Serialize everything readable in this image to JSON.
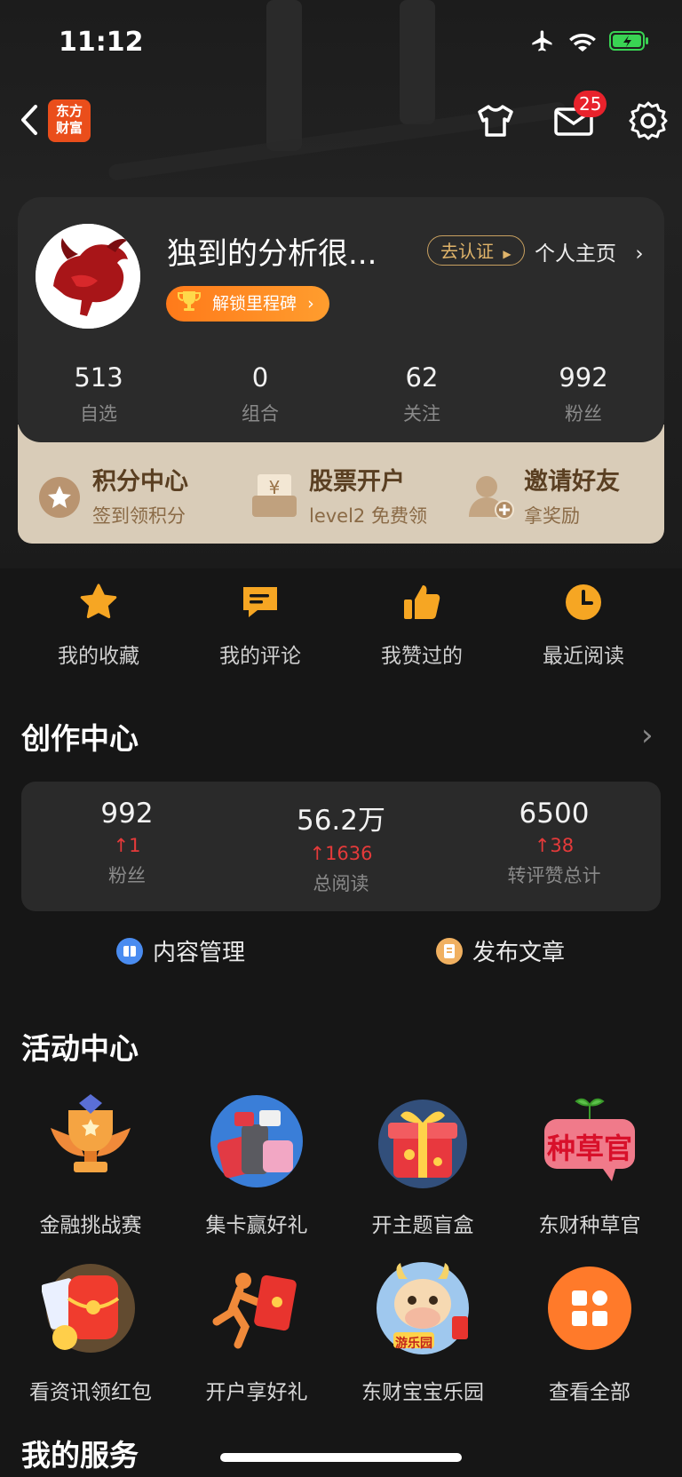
{
  "status_bar": {
    "time": "11:12"
  },
  "nav": {
    "logo_text": "东方\n财富",
    "mail_badge": "25"
  },
  "profile": {
    "username": "独到的分析很...",
    "verify_label": "去认证",
    "homepage_label": "个人主页",
    "milestone_label": "解锁里程碑",
    "stats": [
      {
        "value": "513",
        "label": "自选"
      },
      {
        "value": "0",
        "label": "组合"
      },
      {
        "value": "62",
        "label": "关注"
      },
      {
        "value": "992",
        "label": "粉丝"
      }
    ]
  },
  "gold_strip": [
    {
      "title": "积分中心",
      "sub": "签到领积分"
    },
    {
      "title": "股票开户",
      "sub": "level2 免费领"
    },
    {
      "title": "邀请好友",
      "sub": "拿奖励"
    }
  ],
  "quick_links": [
    {
      "label": "我的收藏",
      "icon": "star-icon"
    },
    {
      "label": "我的评论",
      "icon": "comment-icon"
    },
    {
      "label": "我赞过的",
      "icon": "thumbs-up-icon"
    },
    {
      "label": "最近阅读",
      "icon": "clock-icon"
    }
  ],
  "creator": {
    "title": "创作中心",
    "stats": [
      {
        "value": "992",
        "delta": "↑1",
        "label": "粉丝"
      },
      {
        "value": "56.2万",
        "delta": "↑1636",
        "label": "总阅读"
      },
      {
        "value": "6500",
        "delta": "↑38",
        "label": "转评赞总计"
      }
    ],
    "content_manage": "内容管理",
    "publish": "发布文章"
  },
  "activity": {
    "title": "活动中心",
    "items": [
      {
        "label": "金融挑战赛"
      },
      {
        "label": "集卡赢好礼"
      },
      {
        "label": "开主题盲盒"
      },
      {
        "label": "东财种草官"
      },
      {
        "label": "看资讯领红包"
      },
      {
        "label": "开户享好礼"
      },
      {
        "label": "东财宝宝乐园"
      },
      {
        "label": "查看全部"
      }
    ],
    "grass_text": "种草官",
    "park_text": "游乐园"
  },
  "services": {
    "title": "我的服务"
  },
  "colors": {
    "accent": "#ff8a1f",
    "up_red": "#e53a3a",
    "gold": "#d9ccb8"
  }
}
